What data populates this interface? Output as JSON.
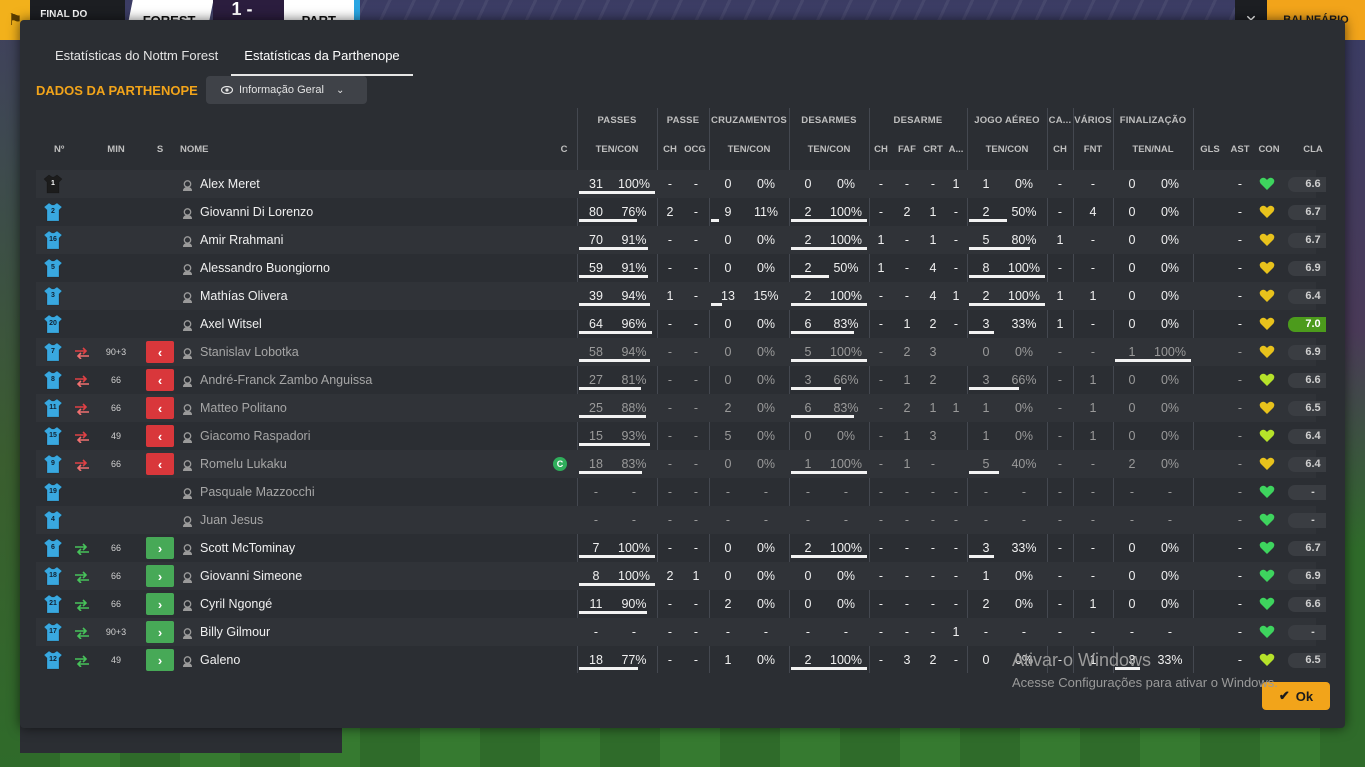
{
  "scoreboard": {
    "final_label": "FINAL DO JOGO",
    "home_team": "FOREST",
    "score": "1 - 0",
    "away_team": "PART",
    "right_button": "BALNEÁRIO",
    "close_glyph": "✕"
  },
  "tabs": [
    {
      "label": "Estatísticas do Nottm Forest",
      "active": false
    },
    {
      "label": "Estatísticas da Parthenope",
      "active": true
    }
  ],
  "section_title": "DADOS DA PARTHENOPE",
  "dropdown": {
    "label": "Informação Geral",
    "icon": "eye-icon"
  },
  "group_headers": {
    "passes": "PASSES",
    "passe": "PASSE",
    "cruzamentos": "CRUZAMENTOS",
    "desarmes": "DESARMES",
    "desarme": "DESARME",
    "jogo_aereo": "JOGO AÉREO",
    "ca": "CA...",
    "varios": "VÁRIOS",
    "finalizacao": "FINALIZAÇÃO"
  },
  "column_headers": {
    "n": "Nº",
    "min": "MIN",
    "s": "S",
    "nome": "NOME",
    "c": "C",
    "passes_ten": "TEN/CON",
    "passe_ch": "CH",
    "passe_ocg": "OCG",
    "cruz_ten": "TEN/CON",
    "desarmes_ten": "TEN/CON",
    "desarme_ch": "CH",
    "desarme_faf": "FAF",
    "desarme_crt": "CRT",
    "desarme_a": "A...",
    "aereo_ten": "TEN/CON",
    "ca_ch": "CH",
    "varios_fnt": "FNT",
    "fin_ten": "TEN/NAL",
    "gls": "GLS",
    "ast": "AST",
    "con": "CON",
    "cla": "CLA"
  },
  "players": [
    {
      "num": "1",
      "kit": "gk",
      "swap": "",
      "min": "",
      "sbtn": "",
      "name": "Alex Meret",
      "captain": false,
      "sub": false,
      "pass_t": "31",
      "pass_p": "100%",
      "pass_fill": 1.0,
      "pch": "-",
      "pocg": "-",
      "cr_t": "0",
      "cr_p": "0%",
      "cr_fill": 0,
      "ds_t": "0",
      "ds_p": "0%",
      "ds_fill": 0,
      "d_ch": "-",
      "d_faf": "-",
      "d_crt": "-",
      "d_a": "1",
      "ae_t": "1",
      "ae_p": "0%",
      "ae_fill": 0,
      "ca_ch": "-",
      "fnt": "-",
      "fin_t": "0",
      "fin_p": "0%",
      "fin_fill": 0,
      "gls": "",
      "ast": "-",
      "con": "green",
      "cla": "6.6",
      "best": false
    },
    {
      "num": "2",
      "kit": "out",
      "swap": "",
      "min": "",
      "sbtn": "",
      "name": "Giovanni Di Lorenzo",
      "captain": false,
      "sub": false,
      "pass_t": "80",
      "pass_p": "76%",
      "pass_fill": 0.76,
      "pch": "2",
      "pocg": "-",
      "cr_t": "9",
      "cr_p": "11%",
      "cr_fill": 0.11,
      "ds_t": "2",
      "ds_p": "100%",
      "ds_fill": 1.0,
      "d_ch": "-",
      "d_faf": "2",
      "d_crt": "1",
      "d_a": "-",
      "ae_t": "2",
      "ae_p": "50%",
      "ae_fill": 0.5,
      "ca_ch": "-",
      "fnt": "4",
      "fin_t": "0",
      "fin_p": "0%",
      "fin_fill": 0,
      "gls": "",
      "ast": "-",
      "con": "yellow",
      "cla": "6.7",
      "best": false
    },
    {
      "num": "16",
      "kit": "out",
      "swap": "",
      "min": "",
      "sbtn": "",
      "name": "Amir Rrahmani",
      "captain": false,
      "sub": false,
      "pass_t": "70",
      "pass_p": "91%",
      "pass_fill": 0.91,
      "pch": "-",
      "pocg": "-",
      "cr_t": "0",
      "cr_p": "0%",
      "cr_fill": 0,
      "ds_t": "2",
      "ds_p": "100%",
      "ds_fill": 1.0,
      "d_ch": "1",
      "d_faf": "-",
      "d_crt": "1",
      "d_a": "-",
      "ae_t": "5",
      "ae_p": "80%",
      "ae_fill": 0.8,
      "ca_ch": "1",
      "fnt": "-",
      "fin_t": "0",
      "fin_p": "0%",
      "fin_fill": 0,
      "gls": "",
      "ast": "-",
      "con": "yellow",
      "cla": "6.7",
      "best": false
    },
    {
      "num": "5",
      "kit": "out",
      "swap": "",
      "min": "",
      "sbtn": "",
      "name": "Alessandro Buongiorno",
      "captain": false,
      "sub": false,
      "pass_t": "59",
      "pass_p": "91%",
      "pass_fill": 0.91,
      "pch": "-",
      "pocg": "-",
      "cr_t": "0",
      "cr_p": "0%",
      "cr_fill": 0,
      "ds_t": "2",
      "ds_p": "50%",
      "ds_fill": 0.5,
      "d_ch": "1",
      "d_faf": "-",
      "d_crt": "4",
      "d_a": "-",
      "ae_t": "8",
      "ae_p": "100%",
      "ae_fill": 1.0,
      "ca_ch": "-",
      "fnt": "-",
      "fin_t": "0",
      "fin_p": "0%",
      "fin_fill": 0,
      "gls": "",
      "ast": "-",
      "con": "yellow",
      "cla": "6.9",
      "best": false
    },
    {
      "num": "3",
      "kit": "out",
      "swap": "",
      "min": "",
      "sbtn": "",
      "name": "Mathías Olivera",
      "captain": false,
      "sub": false,
      "pass_t": "39",
      "pass_p": "94%",
      "pass_fill": 0.94,
      "pch": "1",
      "pocg": "-",
      "cr_t": "13",
      "cr_p": "15%",
      "cr_fill": 0.15,
      "ds_t": "2",
      "ds_p": "100%",
      "ds_fill": 1.0,
      "d_ch": "-",
      "d_faf": "-",
      "d_crt": "4",
      "d_a": "1",
      "ae_t": "2",
      "ae_p": "100%",
      "ae_fill": 1.0,
      "ca_ch": "1",
      "fnt": "1",
      "fin_t": "0",
      "fin_p": "0%",
      "fin_fill": 0,
      "gls": "",
      "ast": "-",
      "con": "yellow",
      "cla": "6.4",
      "best": false
    },
    {
      "num": "20",
      "kit": "out",
      "swap": "",
      "min": "",
      "sbtn": "",
      "name": "Axel Witsel",
      "captain": false,
      "sub": false,
      "pass_t": "64",
      "pass_p": "96%",
      "pass_fill": 0.96,
      "pch": "-",
      "pocg": "-",
      "cr_t": "0",
      "cr_p": "0%",
      "cr_fill": 0,
      "ds_t": "6",
      "ds_p": "83%",
      "ds_fill": 0.83,
      "d_ch": "-",
      "d_faf": "1",
      "d_crt": "2",
      "d_a": "-",
      "ae_t": "3",
      "ae_p": "33%",
      "ae_fill": 0.33,
      "ca_ch": "1",
      "fnt": "-",
      "fin_t": "0",
      "fin_p": "0%",
      "fin_fill": 0,
      "gls": "",
      "ast": "-",
      "con": "yellow",
      "cla": "7.0",
      "best": true
    },
    {
      "num": "7",
      "kit": "out",
      "swap": "off",
      "min": "90+3",
      "sbtn": "off",
      "name": "Stanislav Lobotka",
      "captain": false,
      "sub": true,
      "pass_t": "58",
      "pass_p": "94%",
      "pass_fill": 0.94,
      "pch": "-",
      "pocg": "-",
      "cr_t": "0",
      "cr_p": "0%",
      "cr_fill": 0,
      "ds_t": "5",
      "ds_p": "100%",
      "ds_fill": 1.0,
      "d_ch": "-",
      "d_faf": "2",
      "d_crt": "3",
      "d_a": "",
      "ae_t": "0",
      "ae_p": "0%",
      "ae_fill": 0,
      "ca_ch": "-",
      "fnt": "-",
      "fin_t": "1",
      "fin_p": "100%",
      "fin_fill": 1.0,
      "gls": "",
      "ast": "-",
      "con": "yellow",
      "cla": "6.9",
      "best": false
    },
    {
      "num": "8",
      "kit": "out",
      "swap": "off",
      "min": "66",
      "sbtn": "off",
      "name": "André-Franck Zambo Anguissa",
      "captain": false,
      "sub": true,
      "pass_t": "27",
      "pass_p": "81%",
      "pass_fill": 0.81,
      "pch": "-",
      "pocg": "-",
      "cr_t": "0",
      "cr_p": "0%",
      "cr_fill": 0,
      "ds_t": "3",
      "ds_p": "66%",
      "ds_fill": 0.66,
      "d_ch": "-",
      "d_faf": "1",
      "d_crt": "2",
      "d_a": "",
      "ae_t": "3",
      "ae_p": "66%",
      "ae_fill": 0.66,
      "ca_ch": "-",
      "fnt": "1",
      "fin_t": "0",
      "fin_p": "0%",
      "fin_fill": 0,
      "gls": "",
      "ast": "-",
      "con": "lime",
      "cla": "6.6",
      "best": false
    },
    {
      "num": "11",
      "kit": "out",
      "swap": "off",
      "min": "66",
      "sbtn": "off",
      "name": "Matteo Politano",
      "captain": false,
      "sub": true,
      "pass_t": "25",
      "pass_p": "88%",
      "pass_fill": 0.88,
      "pch": "-",
      "pocg": "-",
      "cr_t": "2",
      "cr_p": "0%",
      "cr_fill": 0,
      "ds_t": "6",
      "ds_p": "83%",
      "ds_fill": 0.83,
      "d_ch": "-",
      "d_faf": "2",
      "d_crt": "1",
      "d_a": "1",
      "ae_t": "1",
      "ae_p": "0%",
      "ae_fill": 0,
      "ca_ch": "-",
      "fnt": "1",
      "fin_t": "0",
      "fin_p": "0%",
      "fin_fill": 0,
      "gls": "",
      "ast": "-",
      "con": "yellow",
      "cla": "6.5",
      "best": false
    },
    {
      "num": "15",
      "kit": "out",
      "swap": "off",
      "min": "49",
      "sbtn": "off",
      "name": "Giacomo Raspadori",
      "captain": false,
      "sub": true,
      "pass_t": "15",
      "pass_p": "93%",
      "pass_fill": 0.93,
      "pch": "-",
      "pocg": "-",
      "cr_t": "5",
      "cr_p": "0%",
      "cr_fill": 0,
      "ds_t": "0",
      "ds_p": "0%",
      "ds_fill": 0,
      "d_ch": "-",
      "d_faf": "1",
      "d_crt": "3",
      "d_a": "",
      "ae_t": "1",
      "ae_p": "0%",
      "ae_fill": 0,
      "ca_ch": "-",
      "fnt": "1",
      "fin_t": "0",
      "fin_p": "0%",
      "fin_fill": 0,
      "gls": "",
      "ast": "-",
      "con": "lime",
      "cla": "6.4",
      "best": false
    },
    {
      "num": "9",
      "kit": "out",
      "swap": "off",
      "min": "66",
      "sbtn": "off",
      "name": "Romelu Lukaku",
      "captain": true,
      "captain_label": "C",
      "sub": true,
      "pass_t": "18",
      "pass_p": "83%",
      "pass_fill": 0.83,
      "pch": "-",
      "pocg": "-",
      "cr_t": "0",
      "cr_p": "0%",
      "cr_fill": 0,
      "ds_t": "1",
      "ds_p": "100%",
      "ds_fill": 1.0,
      "d_ch": "-",
      "d_faf": "1",
      "d_crt": "-",
      "d_a": "",
      "ae_t": "5",
      "ae_p": "40%",
      "ae_fill": 0.4,
      "ca_ch": "-",
      "fnt": "-",
      "fin_t": "2",
      "fin_p": "0%",
      "fin_fill": 0,
      "gls": "",
      "ast": "-",
      "con": "yellow",
      "cla": "6.4",
      "best": false
    },
    {
      "num": "19",
      "kit": "out",
      "swap": "",
      "min": "",
      "sbtn": "",
      "name": "Pasquale Mazzocchi",
      "captain": false,
      "sub": true,
      "pass_t": "-",
      "pass_p": "-",
      "pass_fill": 0,
      "pch": "-",
      "pocg": "-",
      "cr_t": "-",
      "cr_p": "-",
      "cr_fill": 0,
      "ds_t": "-",
      "ds_p": "-",
      "ds_fill": 0,
      "d_ch": "-",
      "d_faf": "-",
      "d_crt": "-",
      "d_a": "-",
      "ae_t": "-",
      "ae_p": "-",
      "ae_fill": 0,
      "ca_ch": "-",
      "fnt": "-",
      "fin_t": "-",
      "fin_p": "-",
      "fin_fill": 0,
      "gls": "",
      "ast": "-",
      "con": "green",
      "cla": "-",
      "best": false
    },
    {
      "num": "4",
      "kit": "out",
      "swap": "",
      "min": "",
      "sbtn": "",
      "name": "Juan Jesus",
      "captain": false,
      "sub": true,
      "pass_t": "-",
      "pass_p": "-",
      "pass_fill": 0,
      "pch": "-",
      "pocg": "-",
      "cr_t": "-",
      "cr_p": "-",
      "cr_fill": 0,
      "ds_t": "-",
      "ds_p": "-",
      "ds_fill": 0,
      "d_ch": "-",
      "d_faf": "-",
      "d_crt": "-",
      "d_a": "-",
      "ae_t": "-",
      "ae_p": "-",
      "ae_fill": 0,
      "ca_ch": "-",
      "fnt": "-",
      "fin_t": "-",
      "fin_p": "-",
      "fin_fill": 0,
      "gls": "",
      "ast": "-",
      "con": "green",
      "cla": "-",
      "best": false
    },
    {
      "num": "6",
      "kit": "out",
      "swap": "on",
      "min": "66",
      "sbtn": "on",
      "name": "Scott McTominay",
      "captain": false,
      "sub": false,
      "pass_t": "7",
      "pass_p": "100%",
      "pass_fill": 1.0,
      "pch": "-",
      "pocg": "-",
      "cr_t": "0",
      "cr_p": "0%",
      "cr_fill": 0,
      "ds_t": "2",
      "ds_p": "100%",
      "ds_fill": 1.0,
      "d_ch": "-",
      "d_faf": "-",
      "d_crt": "-",
      "d_a": "-",
      "ae_t": "3",
      "ae_p": "33%",
      "ae_fill": 0.33,
      "ca_ch": "-",
      "fnt": "-",
      "fin_t": "0",
      "fin_p": "0%",
      "fin_fill": 0,
      "gls": "",
      "ast": "-",
      "con": "green",
      "cla": "6.7",
      "best": false
    },
    {
      "num": "18",
      "kit": "out",
      "swap": "on",
      "min": "66",
      "sbtn": "on",
      "name": "Giovanni Simeone",
      "captain": false,
      "sub": false,
      "pass_t": "8",
      "pass_p": "100%",
      "pass_fill": 1.0,
      "pch": "2",
      "pocg": "1",
      "cr_t": "0",
      "cr_p": "0%",
      "cr_fill": 0,
      "ds_t": "0",
      "ds_p": "0%",
      "ds_fill": 0,
      "d_ch": "-",
      "d_faf": "-",
      "d_crt": "-",
      "d_a": "-",
      "ae_t": "1",
      "ae_p": "0%",
      "ae_fill": 0,
      "ca_ch": "-",
      "fnt": "-",
      "fin_t": "0",
      "fin_p": "0%",
      "fin_fill": 0,
      "gls": "",
      "ast": "-",
      "con": "green",
      "cla": "6.9",
      "best": false
    },
    {
      "num": "21",
      "kit": "out",
      "swap": "on",
      "min": "66",
      "sbtn": "on",
      "name": "Cyril Ngongé",
      "captain": false,
      "sub": false,
      "pass_t": "11",
      "pass_p": "90%",
      "pass_fill": 0.9,
      "pch": "-",
      "pocg": "-",
      "cr_t": "2",
      "cr_p": "0%",
      "cr_fill": 0,
      "ds_t": "0",
      "ds_p": "0%",
      "ds_fill": 0,
      "d_ch": "-",
      "d_faf": "-",
      "d_crt": "-",
      "d_a": "-",
      "ae_t": "2",
      "ae_p": "0%",
      "ae_fill": 0,
      "ca_ch": "-",
      "fnt": "1",
      "fin_t": "0",
      "fin_p": "0%",
      "fin_fill": 0,
      "gls": "",
      "ast": "-",
      "con": "green",
      "cla": "6.6",
      "best": false
    },
    {
      "num": "17",
      "kit": "out",
      "swap": "on",
      "min": "90+3",
      "sbtn": "on",
      "name": "Billy Gilmour",
      "captain": false,
      "sub": false,
      "pass_t": "-",
      "pass_p": "-",
      "pass_fill": 0,
      "pch": "-",
      "pocg": "-",
      "cr_t": "-",
      "cr_p": "-",
      "cr_fill": 0,
      "ds_t": "-",
      "ds_p": "-",
      "ds_fill": 0,
      "d_ch": "-",
      "d_faf": "-",
      "d_crt": "-",
      "d_a": "1",
      "ae_t": "-",
      "ae_p": "-",
      "ae_fill": 0,
      "ca_ch": "-",
      "fnt": "-",
      "fin_t": "-",
      "fin_p": "-",
      "fin_fill": 0,
      "gls": "",
      "ast": "-",
      "con": "green",
      "cla": "-",
      "best": false
    },
    {
      "num": "12",
      "kit": "out",
      "swap": "on",
      "min": "49",
      "sbtn": "on",
      "name": "Galeno",
      "captain": false,
      "sub": false,
      "pass_t": "18",
      "pass_p": "77%",
      "pass_fill": 0.77,
      "pch": "-",
      "pocg": "-",
      "cr_t": "1",
      "cr_p": "0%",
      "cr_fill": 0,
      "ds_t": "2",
      "ds_p": "100%",
      "ds_fill": 1.0,
      "d_ch": "-",
      "d_faf": "3",
      "d_crt": "2",
      "d_a": "-",
      "ae_t": "0",
      "ae_p": "0%",
      "ae_fill": 0,
      "ca_ch": "-",
      "fnt": "1",
      "fin_t": "3",
      "fin_p": "33%",
      "fin_fill": 0.33,
      "gls": "",
      "ast": "-",
      "con": "lime",
      "cla": "6.5",
      "best": false
    }
  ],
  "colors": {
    "accent": "#f2a41a",
    "red": "#d9373b",
    "green": "#47a957",
    "best_rating": "#4c9b1c",
    "kit": "#39a8e0"
  },
  "watermark": {
    "line1": "Ativar o Windows",
    "line2": "Acesse Configurações para ativar o Windows."
  },
  "ok_button": {
    "label": "Ok"
  }
}
